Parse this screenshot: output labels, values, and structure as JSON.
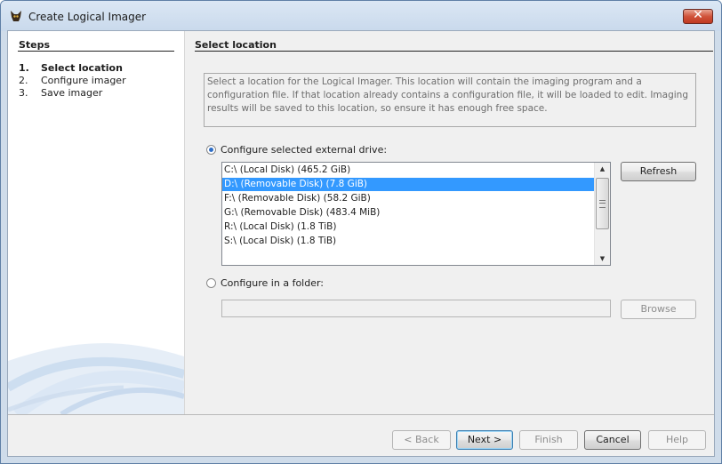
{
  "window": {
    "title": "Create Logical Imager",
    "close_label": "✕"
  },
  "steps": {
    "title": "Steps",
    "items": [
      {
        "num": "1.",
        "label": "Select location"
      },
      {
        "num": "2.",
        "label": "Configure imager"
      },
      {
        "num": "3.",
        "label": "Save imager"
      }
    ],
    "current": 0
  },
  "main": {
    "title": "Select location",
    "description": "Select a location for the Logical Imager. This location will contain the imaging program and a configuration file. If that location already contains a configuration file, it will be loaded to edit. Imaging results will be saved to this location, so ensure it has enough free space.",
    "drive_option": {
      "label": "Configure selected external drive:",
      "selected": true
    },
    "drives": [
      "C:\\ (Local Disk) (465.2 GiB)",
      "D:\\ (Removable Disk) (7.8 GiB)",
      "F:\\ (Removable Disk) (58.2 GiB)",
      "G:\\ (Removable Disk) (483.4 MiB)",
      "R:\\ (Local Disk) (1.8 TiB)",
      "S:\\ (Local Disk) (1.8 TiB)"
    ],
    "selected_drive_index": 1,
    "refresh_label": "Refresh",
    "folder_option": {
      "label": "Configure in a folder:",
      "selected": false
    },
    "folder_value": "",
    "browse_label": "Browse"
  },
  "footer": {
    "back": "< Back",
    "next": "Next >",
    "finish": "Finish",
    "cancel": "Cancel",
    "help": "Help"
  },
  "colors": {
    "selection": "#3399ff",
    "radio_dot": "#2e6ec6",
    "title_bar": "#c9d9ec"
  }
}
